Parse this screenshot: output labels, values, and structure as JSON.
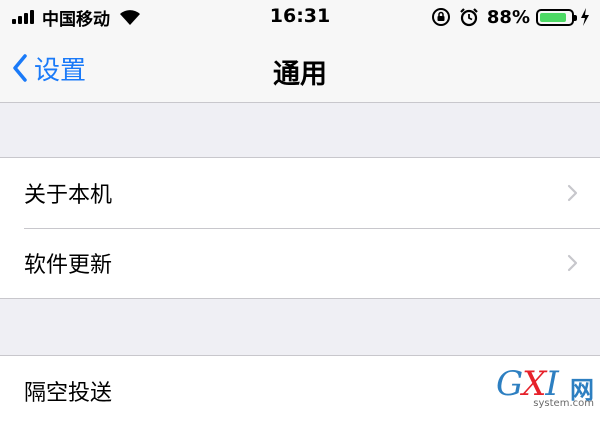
{
  "status_bar": {
    "carrier": "中国移动",
    "time": "16:31",
    "battery_percent": "88%",
    "battery_level": 0.88,
    "icons": [
      "signal-icon",
      "wifi-icon",
      "orientation-lock-icon",
      "alarm-icon",
      "battery-icon",
      "charging-icon"
    ],
    "battery_color": "#4cd964"
  },
  "nav": {
    "back_label": "设置",
    "title": "通用",
    "accent_color": "#1a7af8"
  },
  "groups": [
    {
      "rows": [
        {
          "label": "关于本机"
        },
        {
          "label": "软件更新"
        }
      ]
    },
    {
      "rows": [
        {
          "label": "隔空投送"
        }
      ]
    }
  ],
  "watermark": {
    "logo_g": "G",
    "logo_x": "X",
    "logo_i": "I",
    "cn": "网",
    "site": "system.com"
  }
}
